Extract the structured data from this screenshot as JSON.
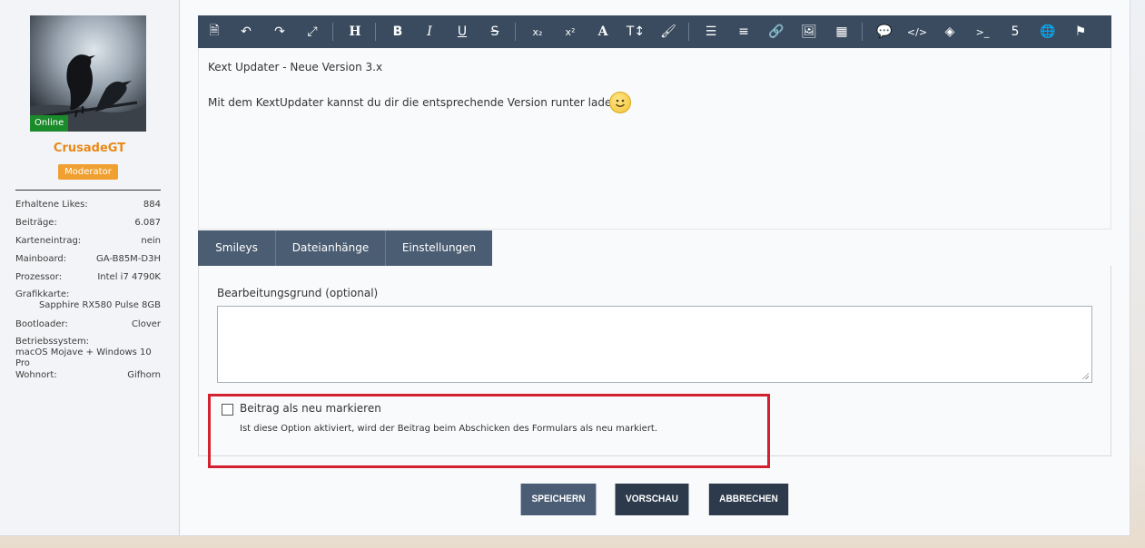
{
  "user": {
    "online_label": "Online",
    "name": "CrusadeGT",
    "rank": "Moderator",
    "fields": [
      {
        "label": "Erhaltene Likes:",
        "value": "884"
      },
      {
        "label": "Beiträge:",
        "value": "6.087"
      },
      {
        "label": "Karteneintrag:",
        "value": "nein"
      },
      {
        "label": "Mainboard:",
        "value": "GA-B85M-D3H"
      },
      {
        "label": "Prozessor:",
        "value": "Intel i7 4790K"
      },
      {
        "label": "Grafikkarte:",
        "value": "Sapphire RX580 Pulse 8GB"
      },
      {
        "label": "Bootloader:",
        "value": "Clover"
      },
      {
        "label": "Betriebssystem:",
        "value": "macOS Mojave + Windows 10 Pro"
      },
      {
        "label": "Wohnort:",
        "value": "Gifhorn"
      }
    ]
  },
  "toolbar": {
    "buttons": [
      {
        "name": "source-icon",
        "glyph": "🗎"
      },
      {
        "name": "undo-icon",
        "glyph": "↶"
      },
      {
        "name": "redo-icon",
        "glyph": "↷"
      },
      {
        "name": "fullscreen-icon",
        "glyph": "⤢"
      },
      {
        "name": "heading-icon",
        "glyph": "H"
      },
      {
        "name": "bold-icon",
        "glyph": "B"
      },
      {
        "name": "italic-icon",
        "glyph": "I"
      },
      {
        "name": "underline-icon",
        "glyph": "U"
      },
      {
        "name": "strikethrough-icon",
        "glyph": "S"
      },
      {
        "name": "subscript-icon",
        "glyph": "x₂"
      },
      {
        "name": "superscript-icon",
        "glyph": "x²"
      },
      {
        "name": "font-color-icon",
        "glyph": "A"
      },
      {
        "name": "font-size-icon",
        "glyph": "T↕"
      },
      {
        "name": "brush-icon",
        "glyph": "🖌"
      },
      {
        "name": "list-icon",
        "glyph": "☰"
      },
      {
        "name": "align-icon",
        "glyph": "≡"
      },
      {
        "name": "link-icon",
        "glyph": "🔗"
      },
      {
        "name": "image-icon",
        "glyph": "🖼"
      },
      {
        "name": "table-icon",
        "glyph": "▦"
      },
      {
        "name": "quote-icon",
        "glyph": "💬"
      },
      {
        "name": "code-icon",
        "glyph": "</>"
      },
      {
        "name": "spoiler-icon",
        "glyph": "◈"
      },
      {
        "name": "terminal-icon",
        "glyph": ">_"
      },
      {
        "name": "html5-icon",
        "glyph": "5"
      },
      {
        "name": "globe-icon",
        "glyph": "🌐"
      },
      {
        "name": "flag-icon",
        "glyph": "⚑"
      }
    ]
  },
  "editor": {
    "line1": "Kext Updater - Neue Version 3.x",
    "line2": "Mit dem KextUpdater kannst du dir die entsprechende Version runter laden"
  },
  "tabs": [
    {
      "label": "Smileys"
    },
    {
      "label": "Dateianhänge"
    },
    {
      "label": "Einstellungen"
    }
  ],
  "settings": {
    "reason_label": "Bearbeitungsgrund (optional)",
    "reason_value": "",
    "mark_new_label": "Beitrag als neu markieren",
    "mark_new_desc": "Ist diese Option aktiviert, wird der Beitrag beim Abschicken des Formulars als neu markiert.",
    "mark_new_checked": false
  },
  "actions": {
    "save": "SPEICHERN",
    "preview": "VORSCHAU",
    "cancel": "ABBRECHEN"
  },
  "colors": {
    "toolbar_bg": "#3a4b5f",
    "highlight": "#d4212f",
    "online": "#1a8a2a",
    "rank_badge": "#f0a030",
    "username": "#e88a1a"
  }
}
